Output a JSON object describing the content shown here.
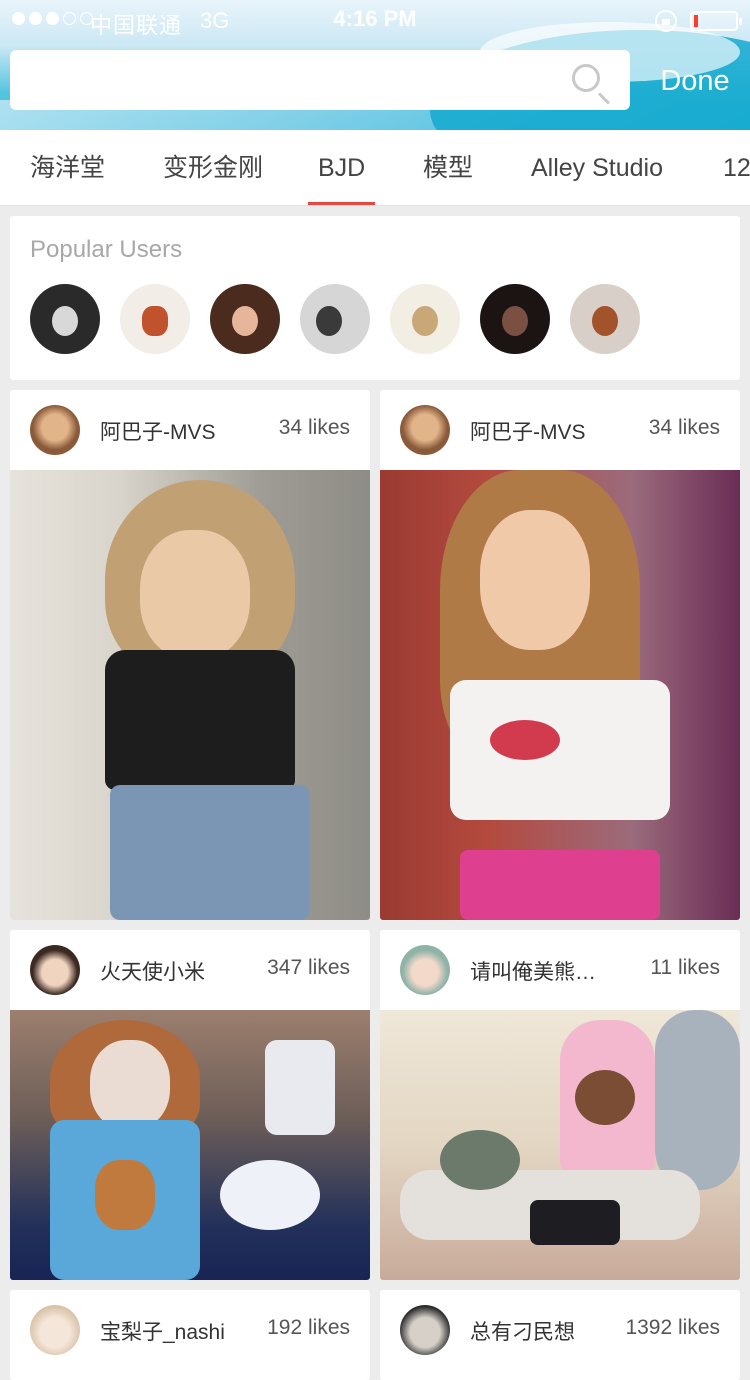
{
  "status": {
    "carrier": "中国联通",
    "network": "3G",
    "time": "4:16 PM"
  },
  "search": {
    "placeholder": "",
    "done_label": "Done"
  },
  "tabs": [
    {
      "label": "海洋堂",
      "active": false
    },
    {
      "label": "变形金刚",
      "active": false
    },
    {
      "label": "BJD",
      "active": true
    },
    {
      "label": "模型",
      "active": false
    },
    {
      "label": "Alley Studio",
      "active": false
    },
    {
      "label": "12",
      "active": false
    }
  ],
  "popular": {
    "title": "Popular Users",
    "avatars": [
      "user-avatar-1",
      "user-avatar-2",
      "user-avatar-3",
      "user-avatar-4",
      "user-avatar-5",
      "user-avatar-6",
      "user-avatar-7"
    ]
  },
  "posts": [
    {
      "user": "阿巴子-MVS",
      "likes": "34 likes"
    },
    {
      "user": "阿巴子-MVS",
      "likes": "34 likes"
    },
    {
      "user": "火天使小米",
      "likes": "347 likes"
    },
    {
      "user": "请叫俺美熊…",
      "likes": "11 likes"
    },
    {
      "user": "宝梨子_nashi",
      "likes": "192 likes"
    },
    {
      "user": "总有刁民想",
      "likes": "1392 likes"
    }
  ],
  "colors": {
    "accent": "#e8463e",
    "header_blue": "#2fb8da"
  }
}
